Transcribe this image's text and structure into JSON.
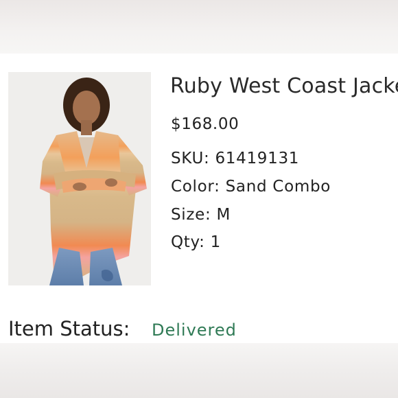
{
  "product": {
    "title": "Ruby West Coast Jacket",
    "price": "$168.00",
    "sku_label": "SKU:",
    "sku_value": "61419131",
    "color_label": "Color:",
    "color_value": "Sand Combo",
    "size_label": "Size:",
    "size_value": "M",
    "qty_label": "Qty:",
    "qty_value": "1"
  },
  "status": {
    "label": "Item Status:",
    "value": "Delivered"
  },
  "colors": {
    "status_delivered": "#2f7a55"
  }
}
